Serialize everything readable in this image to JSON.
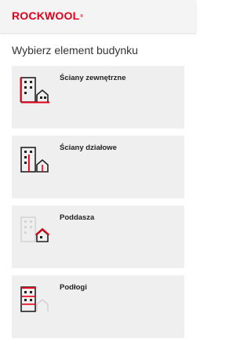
{
  "header": {
    "logo_text": "ROCKWOOL",
    "logo_mark": "®",
    "brand_color": "#e2001a"
  },
  "main": {
    "title": "Wybierz element budynku",
    "items": [
      {
        "label": "Ściany zewnętrzne",
        "icon": "external-walls-icon"
      },
      {
        "label": "Ściany działowe",
        "icon": "partition-walls-icon"
      },
      {
        "label": "Poddasza",
        "icon": "attic-icon"
      },
      {
        "label": "Podłogi",
        "icon": "floors-icon"
      }
    ]
  },
  "colors": {
    "accent": "#e2001a",
    "card_bg": "#efefef",
    "header_bg": "#f4f4f4",
    "icon_dark": "#222222"
  }
}
